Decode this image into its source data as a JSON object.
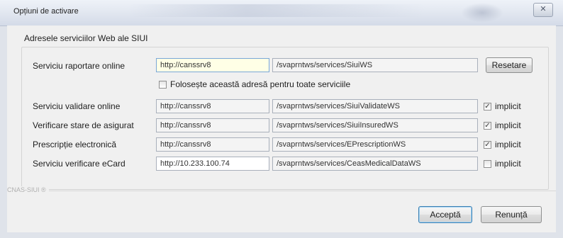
{
  "window": {
    "title": "Opțiuni de activare",
    "close_symbol": "✕"
  },
  "group": {
    "title": "Adresele serviciilor Web ale SIUI"
  },
  "rows": [
    {
      "label": "Serviciu raportare online",
      "host": "http://canssrv8",
      "path": "/svaprntws/services/SiuiWS",
      "action_label": "Resetare"
    },
    {
      "label": "Serviciu validare online",
      "host": "http://canssrv8",
      "path": "/svaprntws/services/SiuiValidateWS",
      "implicit_checked": true,
      "implicit_label": "implicit"
    },
    {
      "label": "Verificare stare de asigurat",
      "host": "http://canssrv8",
      "path": "/svaprntws/services/SiuiInsuredWS",
      "implicit_checked": true,
      "implicit_label": "implicit"
    },
    {
      "label": "Prescripție electronică",
      "host": "http://canssrv8",
      "path": "/svaprntws/services/EPrescriptionWS",
      "implicit_checked": true,
      "implicit_label": "implicit"
    },
    {
      "label": "Serviciu verificare eCard",
      "host": "http://10.233.100.74",
      "path": "/svaprntws/services/CeasMedicalDataWS",
      "implicit_checked": false,
      "implicit_label": "implicit"
    }
  ],
  "use_for_all": {
    "label": "Folosește această adresă pentru toate serviciile",
    "checked": false
  },
  "footer_brand": "CNAS-SIUI ®",
  "buttons": {
    "accept": "Acceptă",
    "cancel": "Renunță"
  },
  "check_mark": "✓"
}
